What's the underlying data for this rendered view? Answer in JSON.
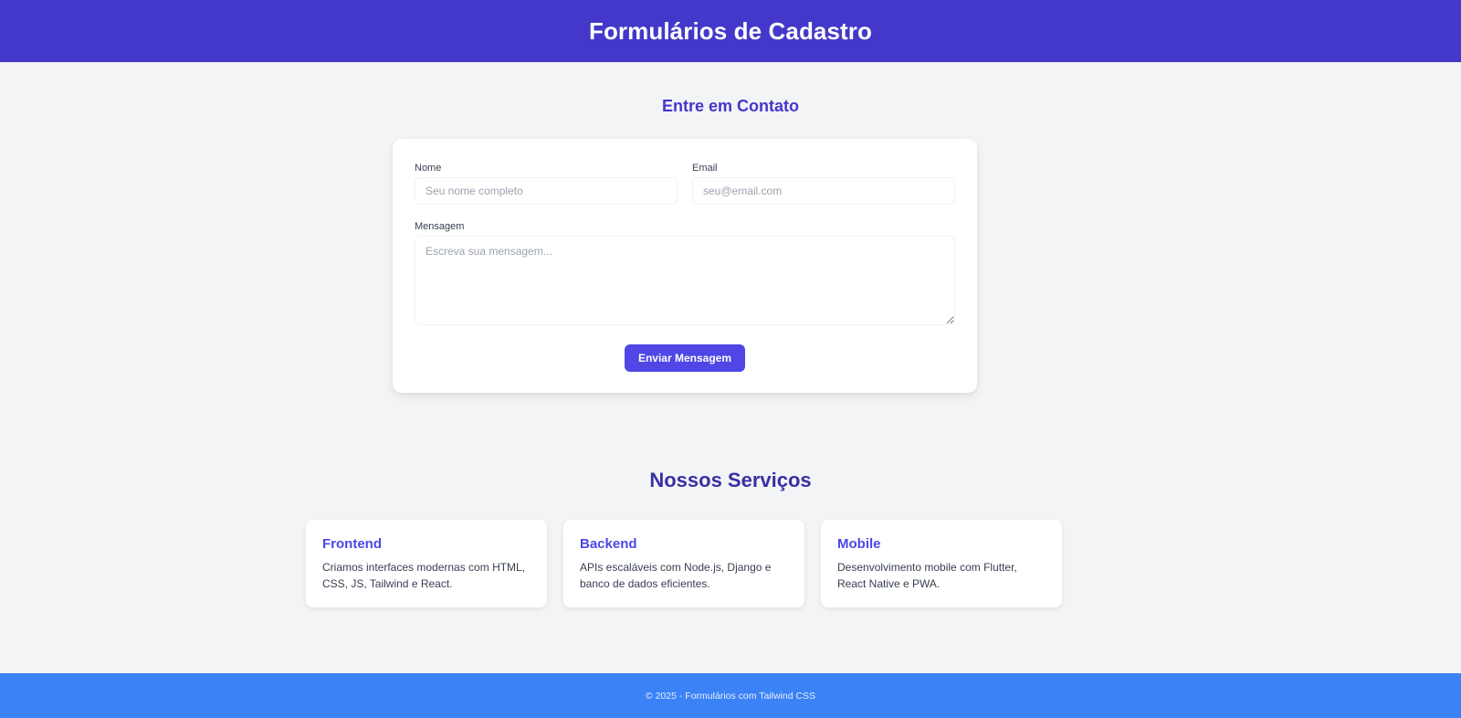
{
  "header": {
    "title": "Formulários de Cadastro"
  },
  "contact": {
    "title": "Entre em Contato",
    "name_label": "Nome",
    "name_placeholder": "Seu nome completo",
    "name_value": "",
    "email_label": "Email",
    "email_placeholder": "seu@email.com",
    "email_value": "",
    "message_label": "Mensagem",
    "message_placeholder": "Escreva sua mensagem...",
    "message_value": "",
    "submit_label": "Enviar Mensagem"
  },
  "services": {
    "title": "Nossos Serviços",
    "items": [
      {
        "title": "Frontend",
        "description": "Criamos interfaces modernas com HTML, CSS, JS, Tailwind e React."
      },
      {
        "title": "Backend",
        "description": "APIs escaláveis com Node.js, Django e banco de dados eficientes."
      },
      {
        "title": "Mobile",
        "description": "Desenvolvimento mobile com Flutter, React Native e PWA."
      }
    ]
  },
  "footer": {
    "text": "© 2025 - Formulários com Tailwind CSS"
  },
  "colors": {
    "header_bg": "#4338ca",
    "primary_button": "#4f46e5",
    "footer_bg": "#3b82f6",
    "page_bg": "#f3f4f6"
  }
}
